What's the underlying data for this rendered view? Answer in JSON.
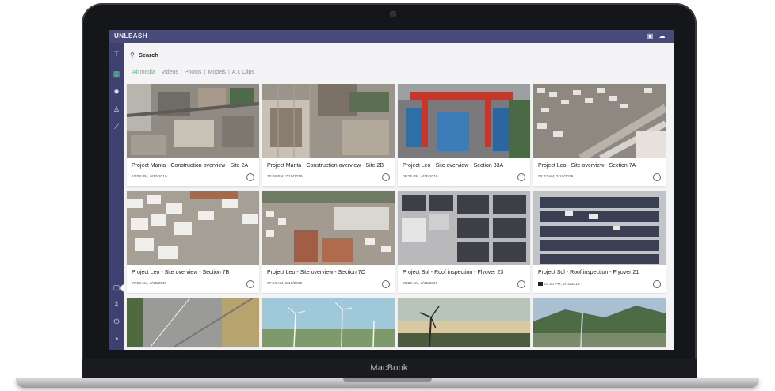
{
  "device": {
    "label": "MacBook"
  },
  "app": {
    "brand": "UNLEASH",
    "top_icons": [
      {
        "name": "camera-icon",
        "glyph": "▣"
      },
      {
        "name": "cloud-upload-icon",
        "glyph": "☁"
      }
    ],
    "accent": "#52c48e",
    "topbar_color": "#484b7a",
    "sidebar_color": "#3e4170"
  },
  "sidebar": {
    "top_items": [
      {
        "name": "drone-icon",
        "glyph": "⊤",
        "active": false
      },
      {
        "name": "media-grid-icon",
        "glyph": "▦",
        "active": true
      },
      {
        "name": "settings-icon",
        "glyph": "✹",
        "active": false
      },
      {
        "name": "flask-icon",
        "glyph": "♙",
        "active": false
      },
      {
        "name": "analytics-icon",
        "glyph": "⟋",
        "active": false
      }
    ],
    "bottom_items": [
      {
        "name": "device-icon",
        "glyph": "▢"
      },
      {
        "name": "resize-icon",
        "glyph": "⇕"
      },
      {
        "name": "power-icon",
        "glyph": "⏻"
      },
      {
        "name": "avatar-icon",
        "glyph": "◔"
      }
    ]
  },
  "search": {
    "placeholder": "Search"
  },
  "filters": [
    {
      "label": "All media",
      "active": true
    },
    {
      "label": "Videos",
      "active": false
    },
    {
      "label": "Photos",
      "active": false
    },
    {
      "label": "Models",
      "active": false
    },
    {
      "label": "A.I. Clips",
      "active": false
    }
  ],
  "cards": [
    {
      "title": "Project Manta - Construction overview - Site 2A",
      "date": "10:08 PM, 6/10/2019",
      "scene": "city"
    },
    {
      "title": "Project Manta - Construction overview - Site 2B",
      "date": "10:08 PM, 7/10/2019",
      "scene": "construction"
    },
    {
      "title": "Project Leo - Site overview - Section 33A",
      "date": "05:26 PM, 4/10/2019",
      "scene": "port"
    },
    {
      "title": "Project Leo - Site overview - Section 7A",
      "date": "08:47 AM, 3/10/2019",
      "scene": "yard"
    },
    {
      "title": "Project Leo - Site overview - Section 7B",
      "date": "07:58 AM, 3/10/2019",
      "scene": "blocks"
    },
    {
      "title": "Project Leo - Site overview - Section 7C",
      "date": "07:56 AM, 3/10/2019",
      "scene": "warehouse"
    },
    {
      "title": "Project Sol - Roof inspection - Flyover 23",
      "date": "03:22 AM, 2/10/2019",
      "scene": "roof"
    },
    {
      "title": "Project Sol - Roof inspection - Flyover 21",
      "date": "03:00 PM, 2/10/2019",
      "scene": "solar",
      "badge": true
    },
    {
      "title": "",
      "date": "",
      "scene": "road"
    },
    {
      "title": "",
      "date": "",
      "scene": "windsky"
    },
    {
      "title": "",
      "date": "",
      "scene": "turbine"
    },
    {
      "title": "",
      "date": "",
      "scene": "hills"
    }
  ]
}
